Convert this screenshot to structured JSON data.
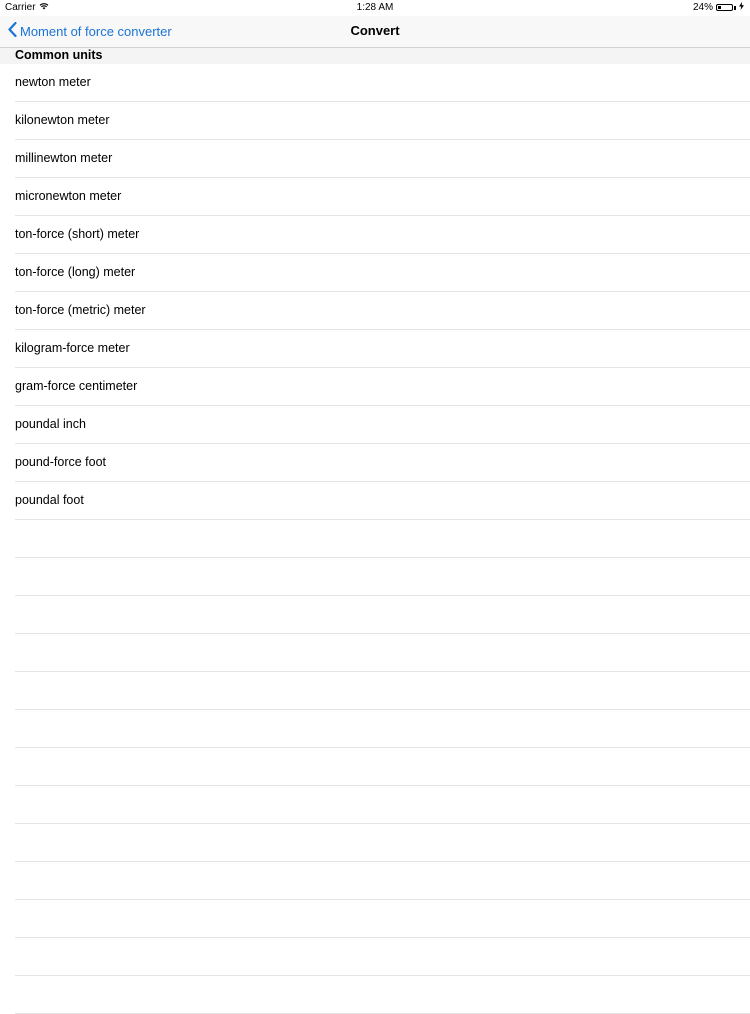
{
  "status_bar": {
    "carrier": "Carrier",
    "time": "1:28 AM",
    "battery_percent": "24%",
    "battery_level": 0.24
  },
  "nav": {
    "back_label": "Moment of force converter",
    "title": "Convert"
  },
  "section": {
    "header": "Common units"
  },
  "units": [
    "newton meter",
    "kilonewton meter",
    "millinewton meter",
    "micronewton meter",
    "ton-force (short) meter",
    "ton-force (long) meter",
    "ton-force (metric) meter",
    "kilogram-force meter",
    "gram-force centimeter",
    "poundal inch",
    "pound-force foot",
    "poundal foot"
  ],
  "colors": {
    "accent": "#1a73d6"
  }
}
